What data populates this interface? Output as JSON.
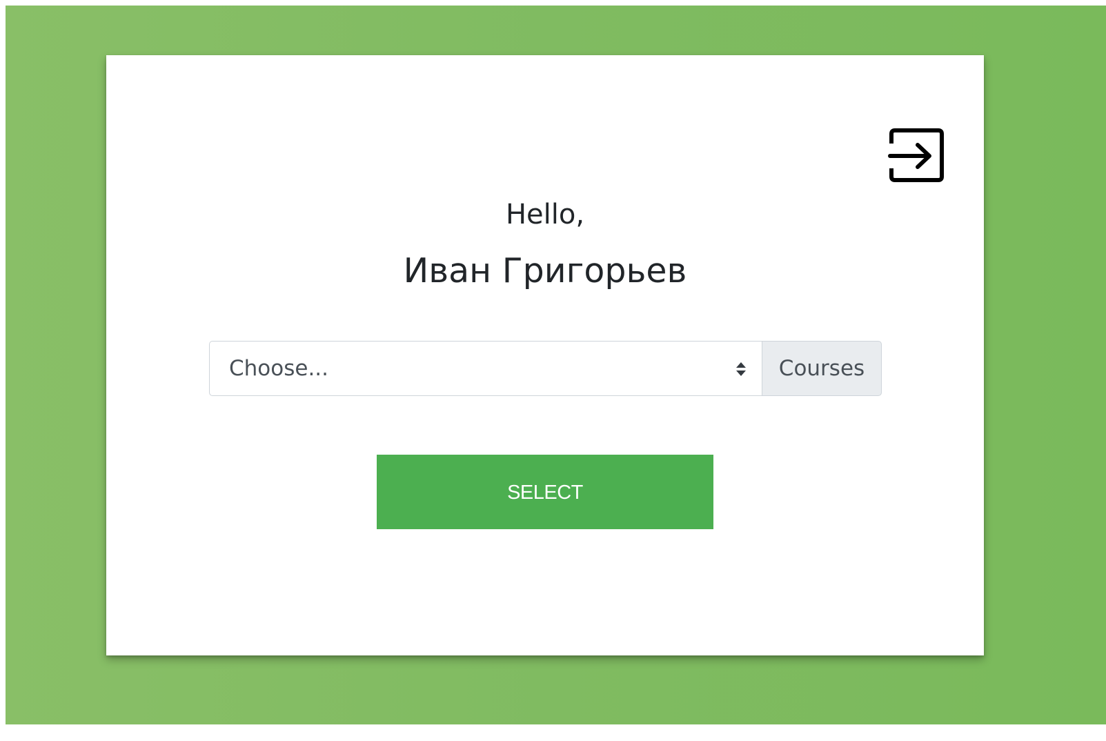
{
  "greeting": {
    "hello": "Hello,",
    "name": "Иван Григорьев"
  },
  "course_select": {
    "selected_value": "Choose...",
    "append_label": "Courses"
  },
  "actions": {
    "select_label": "SELECT",
    "logout_icon": "logout-arrow-icon"
  },
  "colors": {
    "background": "#80bb61",
    "button": "#4caf50",
    "append_bg": "#e9ecef"
  }
}
